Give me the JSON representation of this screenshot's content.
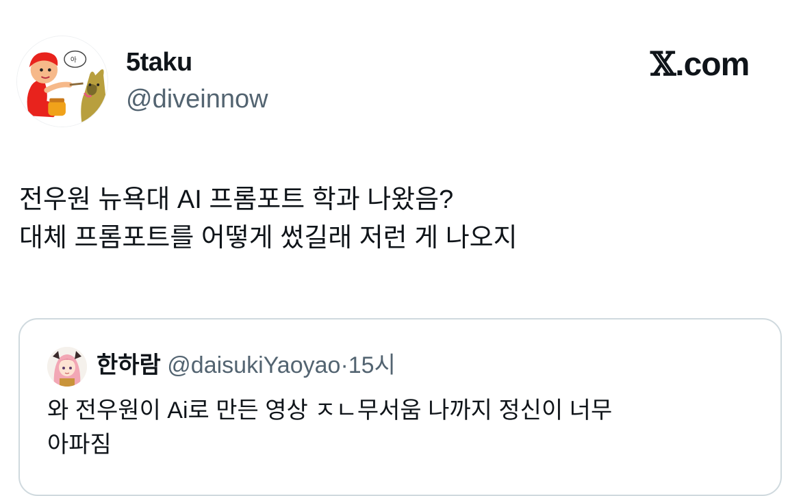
{
  "author": {
    "display_name": "5taku",
    "handle": "@diveinnow",
    "avatar_icon": "cartoon-avatar-icon"
  },
  "brand": {
    "logo_glyph": "𝕏",
    "logo_text": ".com"
  },
  "tweet": {
    "lines": [
      "전우원 뉴욕대 AI 프롬포트 학과 나왔음?",
      "대체 프롬포트를 어떻게 썼길래 저런 게 나오지"
    ]
  },
  "quote": {
    "display_name": "한하람",
    "handle": "@daisukiYaoyao",
    "separator": "·",
    "time": "15시",
    "lines": [
      "와 전우원이 Ai로 만든 영상 ㅈㄴ무서움 나까지 정신이 너무",
      "아파짐"
    ]
  },
  "colors": {
    "text_primary": "#0f1419",
    "text_secondary": "#536471",
    "border": "#cfd9de"
  }
}
